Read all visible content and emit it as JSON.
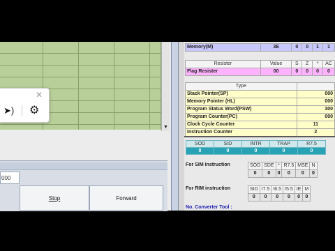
{
  "memory_row": {
    "label": "Memory(M)",
    "value": "3E",
    "bits": [
      "0",
      "0",
      "1",
      "1"
    ]
  },
  "flag_header": [
    "Resister",
    "Value",
    "S",
    "Z",
    "*",
    "AC"
  ],
  "flag_row": {
    "label": "Flag Resister",
    "value": "00",
    "bits": [
      "0",
      "0",
      "0",
      "0"
    ]
  },
  "register_header": "Type",
  "registers": [
    {
      "label": "Stack Pointer(SP)",
      "value": "000"
    },
    {
      "label": "Memory Pointer (HL)",
      "value": "000"
    },
    {
      "label": "Program Status Word(PSW)",
      "value": "300"
    },
    {
      "label": "Program Counter(PC)",
      "value": "000"
    },
    {
      "label": "Clock Cycle Counter",
      "value": "11"
    },
    {
      "label": "Instruction Counter",
      "value": "2"
    }
  ],
  "interrupts": {
    "headers": [
      "SOD",
      "SID",
      "INTR",
      "TRAP",
      "R7.5"
    ],
    "values": [
      "0",
      "0",
      "0",
      "0",
      "0"
    ]
  },
  "sim": {
    "label": "For SIM instruction",
    "headers": [
      "SOD",
      "SDE",
      "*",
      "R7.5",
      "MSE",
      "N"
    ],
    "values": [
      "0",
      "0",
      "0",
      "0",
      "0",
      "0"
    ]
  },
  "rim": {
    "label": "For RIM instruction",
    "headers": [
      "SID",
      "I7.5",
      "I6.5",
      "I5.5",
      "IE",
      "M"
    ],
    "values": [
      "0",
      "0",
      "0",
      "0",
      "0",
      "0"
    ]
  },
  "converter_label": "No. Converter Tool :",
  "address_field": "000",
  "controls": {
    "stop": "Stop",
    "forward": "Forward"
  },
  "popup": {
    "close": "✕",
    "cursor": "pointer-sound-icon",
    "gear": "gear-icon"
  }
}
